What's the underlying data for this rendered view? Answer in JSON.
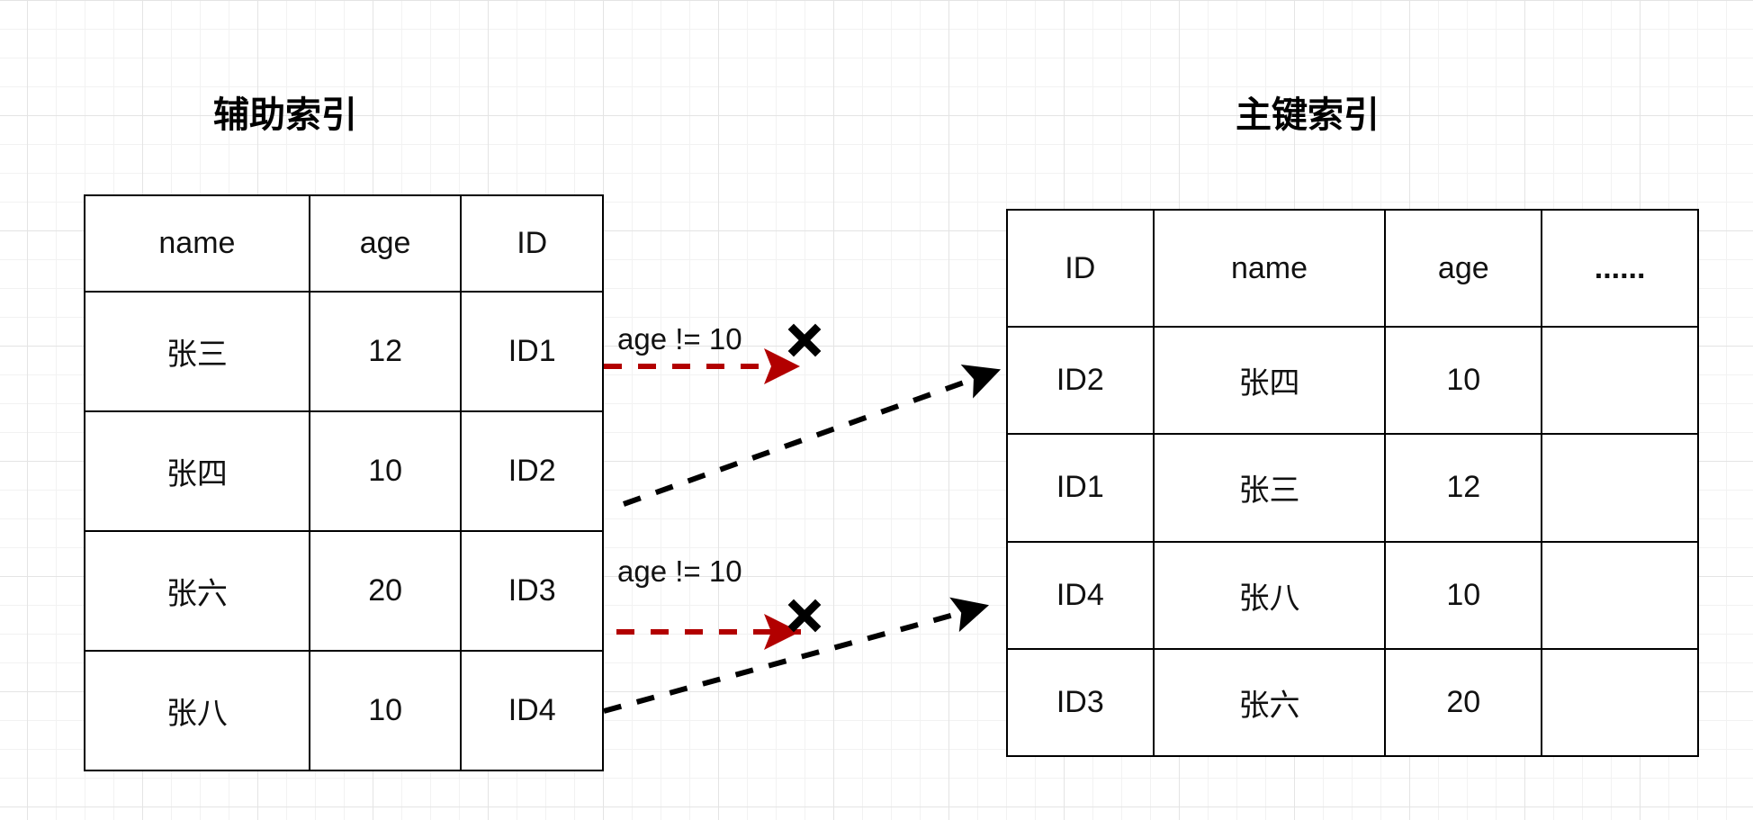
{
  "secondary_index": {
    "title": "辅助索引",
    "headers": [
      "name",
      "age",
      "ID"
    ],
    "rows": [
      [
        "张三",
        "12",
        "ID1"
      ],
      [
        "张四",
        "10",
        "ID2"
      ],
      [
        "张六",
        "20",
        "ID3"
      ],
      [
        "张八",
        "10",
        "ID4"
      ]
    ]
  },
  "primary_index": {
    "title": "主键索引",
    "headers": [
      "ID",
      "name",
      "age",
      "......"
    ],
    "rows": [
      [
        "ID2",
        "张四",
        "10",
        ""
      ],
      [
        "ID1",
        "张三",
        "12",
        ""
      ],
      [
        "ID4",
        "张八",
        "10",
        ""
      ],
      [
        "ID3",
        "张六",
        "20",
        ""
      ]
    ]
  },
  "conditions": [
    {
      "label": "age != 10",
      "mark": "✕"
    },
    {
      "label": "age != 10",
      "mark": "✕"
    }
  ],
  "colors": {
    "rejected_arrow": "#b20000",
    "lookup_arrow": "#000000"
  }
}
